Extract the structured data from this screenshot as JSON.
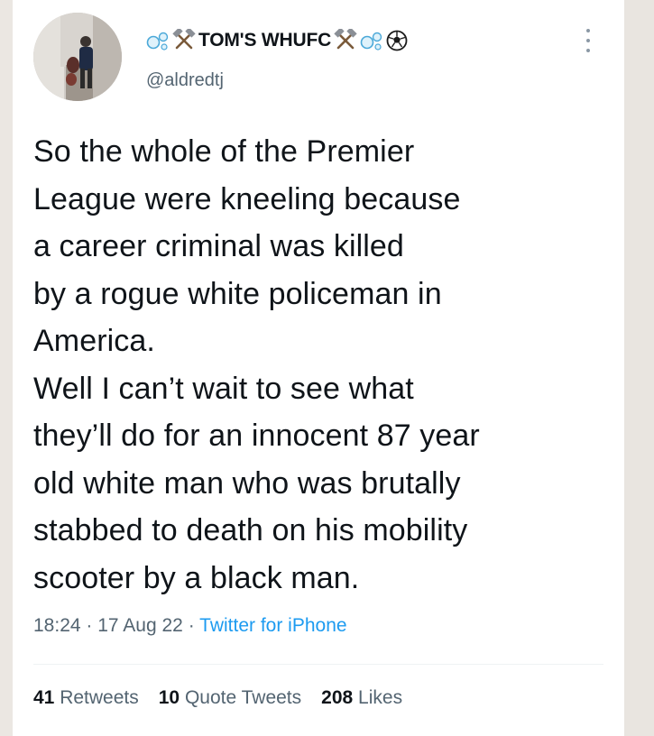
{
  "user": {
    "display_name": "TOM'S WHUFC",
    "handle": "@aldredtj",
    "name_icons": [
      "bubbles-icon",
      "crossed-hammers-icon",
      "crossed-hammers-icon",
      "bubbles-icon",
      "football-icon"
    ]
  },
  "tweet": {
    "text": "So the whole of the Premier\nLeague were kneeling because\na career criminal was killed\nby a rogue white policeman in\nAmerica.\nWell I can’t wait to see what\nthey’ll do for an innocent 87 year\nold white man who was brutally\nstabbed to death on his mobility\nscooter by a black man.",
    "time": "18:24",
    "date": "17 Aug 22",
    "separator": "·",
    "source": "Twitter for iPhone"
  },
  "stats": {
    "retweets_count": "41",
    "retweets_label": "Retweets",
    "quotes_count": "10",
    "quotes_label": "Quote Tweets",
    "likes_count": "208",
    "likes_label": "Likes"
  },
  "colors": {
    "text": "#0f1419",
    "secondary": "#536471",
    "link": "#1d9bf0",
    "hammer": "#7a263a"
  }
}
